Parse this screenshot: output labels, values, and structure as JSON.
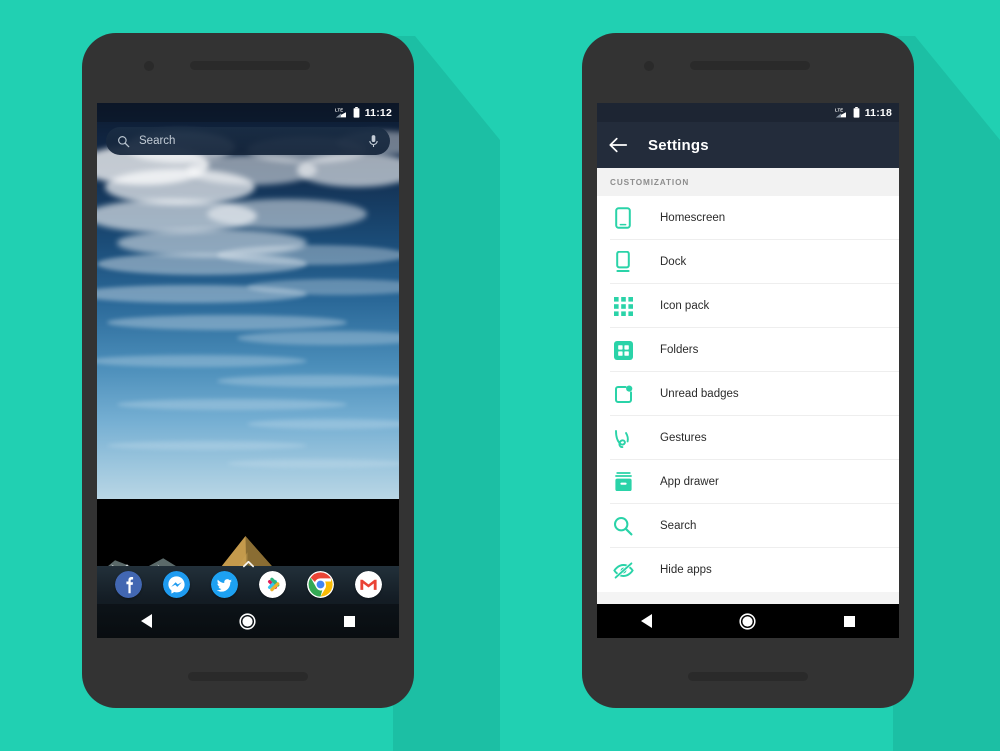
{
  "theme": {
    "background_color": "#21D0B2",
    "shadow_color": "#1CBFA4",
    "phone_body_color": "#333333",
    "accent_teal": "#2ad3a8",
    "appbar_color": "#232c3b",
    "statusbar_color": "#1d2533"
  },
  "left_phone": {
    "name": "homescreen-phone",
    "status_bar": {
      "signal_icon": "lte-signal-icon",
      "signal_label": "LTE",
      "battery_icon": "battery-icon",
      "time": "11:12"
    },
    "search": {
      "icon": "search-icon",
      "placeholder": "Search",
      "mic_icon": "microphone-icon"
    },
    "drawer_handle": {
      "icon": "chevron-up-icon",
      "glyph": "⌃"
    },
    "dock": {
      "apps": [
        {
          "name": "facebook",
          "label": "Facebook",
          "color": "#3b5998"
        },
        {
          "name": "messenger",
          "label": "Messenger",
          "color": "#1e9bf0"
        },
        {
          "name": "twitter",
          "label": "Twitter",
          "color": "#1da1f2"
        },
        {
          "name": "slack",
          "label": "Slack",
          "color": "#ffffff"
        },
        {
          "name": "chrome",
          "label": "Chrome",
          "color": "#ffffff"
        },
        {
          "name": "gmail",
          "label": "Gmail",
          "color": "#ffffff"
        }
      ]
    },
    "nav_bar": {
      "back": "back-button",
      "home": "home-button",
      "recents": "recents-button"
    }
  },
  "right_phone": {
    "name": "settings-phone",
    "status_bar": {
      "signal_icon": "lte-signal-icon",
      "signal_label": "LTE",
      "battery_icon": "battery-icon",
      "time": "11:18"
    },
    "app_bar": {
      "back_icon": "arrow-back-icon",
      "title": "Settings"
    },
    "section_header": "CUSTOMIZATION",
    "settings_items": [
      {
        "label": "Homescreen",
        "icon": "phone-outline-icon"
      },
      {
        "label": "Dock",
        "icon": "dock-icon"
      },
      {
        "label": "Icon pack",
        "icon": "grid-dots-icon"
      },
      {
        "label": "Folders",
        "icon": "folder-grid-icon"
      },
      {
        "label": "Unread badges",
        "icon": "badge-icon"
      },
      {
        "label": "Gestures",
        "icon": "gesture-swirl-icon"
      },
      {
        "label": "App drawer",
        "icon": "drawer-box-icon"
      },
      {
        "label": "Search",
        "icon": "magnifier-icon"
      },
      {
        "label": "Hide apps",
        "icon": "eye-off-icon"
      }
    ],
    "nav_bar": {
      "back": "back-button",
      "home": "home-button",
      "recents": "recents-button"
    }
  }
}
